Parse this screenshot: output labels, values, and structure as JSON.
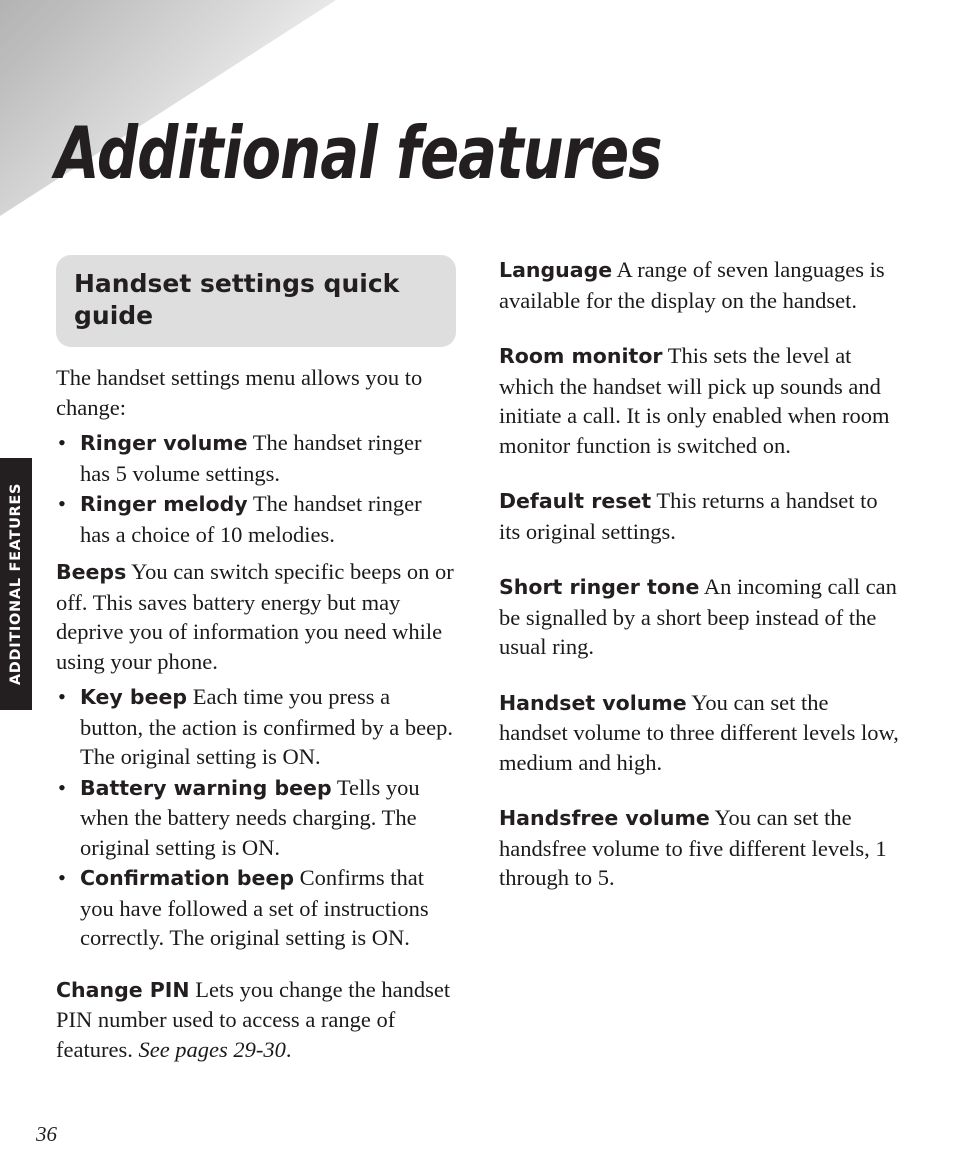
{
  "page": {
    "title": "Additional features",
    "number": "36",
    "side_tab_label": "ADDITIONAL FEATURES",
    "accent_dark": "#231f20",
    "heading_plate_bg": "#dedede",
    "corner_gradient_from": "#b3b3b3",
    "corner_gradient_to": "#ffffff"
  },
  "left_column": {
    "section_heading": "Handset settings quick guide",
    "intro": "The handset settings menu allows you to change:",
    "settings_bullets": [
      {
        "lead": "Ringer volume",
        "text": " The handset ringer has 5 volume settings."
      },
      {
        "lead": "Ringer melody",
        "text": " The handset ringer has a choice of 10 melodies."
      }
    ],
    "beeps": {
      "lead": "Beeps",
      "text": " You can switch specific beeps on or off. This saves battery energy but may deprive you of information you need while using your phone."
    },
    "beeps_bullets": [
      {
        "lead": "Key beep",
        "text": " Each time you press a button, the action is confirmed by a beep. The original setting is ON."
      },
      {
        "lead": "Battery warning beep",
        "text": " Tells you when the battery needs charging. The original setting is ON."
      },
      {
        "lead": "Confirmation beep",
        "text": " Confirms that you have followed a set of instructions correctly. The original setting is ON."
      }
    ],
    "change_pin": {
      "lead": "Change PIN",
      "text": " Lets you change the handset PIN number used to access a range of features. ",
      "reference": "See pages 29-30",
      "trailing": "."
    }
  },
  "right_column": {
    "entries": [
      {
        "lead": "Language",
        "text": " A range of seven languages is available for the display on the handset."
      },
      {
        "lead": "Room monitor",
        "text": " This sets the level at which the handset will pick up sounds and initiate a call. It is only enabled when room monitor function is switched on."
      },
      {
        "lead": "Default reset",
        "text": " This returns a handset to its original settings."
      },
      {
        "lead": "Short ringer tone",
        "text": " An incoming call can be signalled by a short beep instead of the usual ring."
      },
      {
        "lead": "Handset volume",
        "text": " You can set the handset volume to three different levels low, medium and high."
      },
      {
        "lead": "Handsfree volume",
        "text": " You can set the handsfree volume to five different levels, 1 through to 5."
      }
    ]
  }
}
